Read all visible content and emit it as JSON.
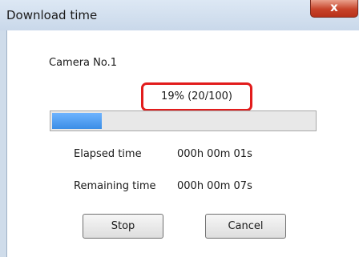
{
  "window": {
    "title": "Download time",
    "close_glyph": "x"
  },
  "camera": {
    "label": "Camera No.1"
  },
  "progress": {
    "percent_text": "19% (20/100)",
    "completed": 20,
    "total": 100,
    "fill_percent": 19,
    "fill_color": "#4a9cf2"
  },
  "times": {
    "elapsed_label": "Elapsed time",
    "elapsed_value": "000h 00m 01s",
    "remaining_label": "Remaining time",
    "remaining_value": "000h 00m 07s"
  },
  "buttons": {
    "stop_label": "Stop",
    "cancel_label": "Cancel"
  },
  "colors": {
    "highlight_box": "#e21c1c",
    "close_button": "#c7432a"
  },
  "icons": {
    "close": "close-icon"
  }
}
